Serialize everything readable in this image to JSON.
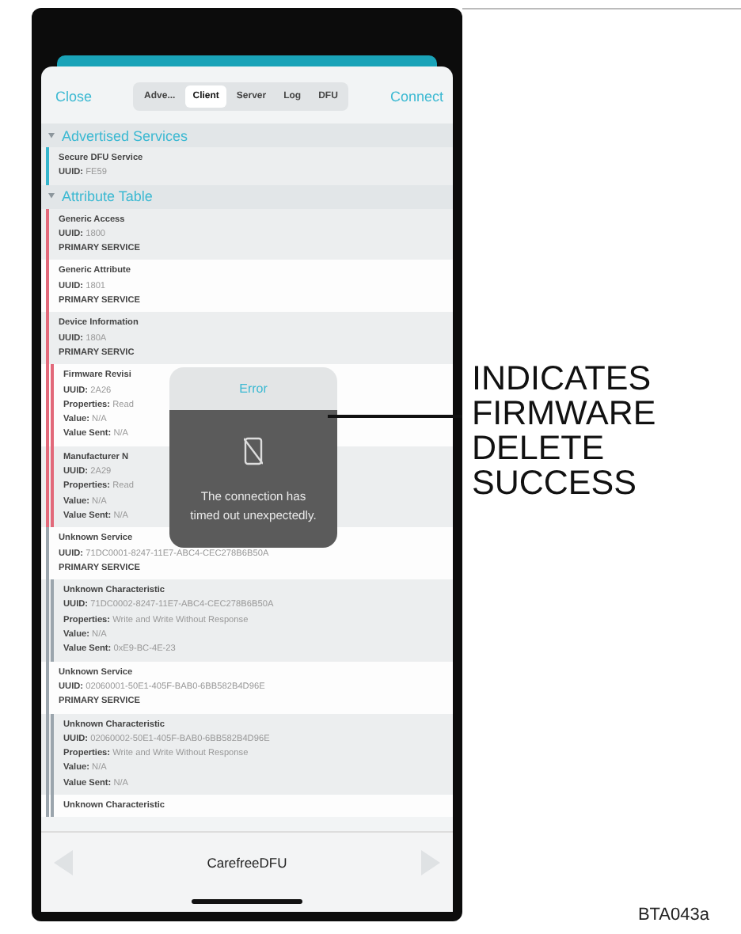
{
  "nav": {
    "close": "Close",
    "connect": "Connect",
    "segments": [
      {
        "label": "Adve...",
        "selected": false
      },
      {
        "label": "Client",
        "selected": true
      },
      {
        "label": "Server",
        "selected": false
      },
      {
        "label": "Log",
        "selected": false
      },
      {
        "label": "DFU",
        "selected": false
      }
    ]
  },
  "sections": [
    {
      "title": "Advertised Services",
      "expanded": true,
      "rows": [
        {
          "kind": "service",
          "color": "#35b5cc",
          "title": "Secure DFU Service",
          "fields": [
            {
              "label": "UUID:",
              "value": "FE59"
            }
          ]
        }
      ]
    },
    {
      "title": "Attribute Table",
      "expanded": true,
      "rows": [
        {
          "kind": "service",
          "color": "#e2697a",
          "title": "Generic Access",
          "fields": [
            {
              "label": "UUID:",
              "value": "1800"
            },
            {
              "label": "PRIMARY SERVICE"
            }
          ]
        },
        {
          "kind": "service",
          "color": "#e2697a",
          "title": "Generic Attribute",
          "fields": [
            {
              "label": "UUID:",
              "value": "1801"
            },
            {
              "label": "PRIMARY SERVICE"
            }
          ]
        },
        {
          "kind": "service",
          "color": "#e2697a",
          "title": "Device Information",
          "fields": [
            {
              "label": "UUID:",
              "value": "180A"
            },
            {
              "label": "PRIMARY SERVIC"
            }
          ]
        },
        {
          "kind": "characteristic",
          "color": "#e2697a",
          "title": "Firmware Revisi",
          "fields": [
            {
              "label": "UUID:",
              "value": "2A26"
            },
            {
              "label": "Properties:",
              "value": "Read"
            },
            {
              "label": "Value:",
              "value": "N/A"
            },
            {
              "label": "Value Sent:",
              "value": "N/A"
            }
          ]
        },
        {
          "kind": "characteristic",
          "color": "#e2697a",
          "title": "Manufacturer N",
          "fields": [
            {
              "label": "UUID:",
              "value": "2A29"
            },
            {
              "label": "Properties:",
              "value": "Read"
            },
            {
              "label": "Value:",
              "value": "N/A"
            },
            {
              "label": "Value Sent:",
              "value": "N/A"
            }
          ]
        },
        {
          "kind": "service",
          "color": "#9ba5ad",
          "title": "Unknown Service",
          "fields": [
            {
              "label": "UUID:",
              "value": "71DC0001-8247-11E7-ABC4-CEC278B6B50A"
            },
            {
              "label": "PRIMARY SERVICE"
            }
          ]
        },
        {
          "kind": "characteristic",
          "color": "#9ba5ad",
          "title": "Unknown Characteristic",
          "fields": [
            {
              "label": "UUID:",
              "value": "71DC0002-8247-11E7-ABC4-CEC278B6B50A"
            },
            {
              "label": "Properties:",
              "value": "Write and Write Without Response"
            },
            {
              "label": "Value:",
              "value": "N/A"
            },
            {
              "label": "Value Sent:",
              "value": "0xE9-BC-4E-23"
            }
          ]
        },
        {
          "kind": "service",
          "color": "#9ba5ad",
          "title": "Unknown Service",
          "fields": [
            {
              "label": "UUID:",
              "value": "02060001-50E1-405F-BAB0-6BB582B4D96E"
            },
            {
              "label": "PRIMARY SERVICE"
            }
          ]
        },
        {
          "kind": "characteristic",
          "color": "#9ba5ad",
          "title": "Unknown Characteristic",
          "fields": [
            {
              "label": "UUID:",
              "value": "02060002-50E1-405F-BAB0-6BB582B4D96E"
            },
            {
              "label": "Properties:",
              "value": "Write and Write Without Response"
            },
            {
              "label": "Value:",
              "value": "N/A"
            },
            {
              "label": "Value Sent:",
              "value": "N/A"
            }
          ]
        },
        {
          "kind": "characteristic",
          "color": "#9ba5ad",
          "title": "Unknown Characteristic",
          "fields": []
        }
      ]
    }
  ],
  "alert": {
    "title": "Error",
    "message": "The connection has timed out unexpectedly."
  },
  "toolbar": {
    "title": "CarefreeDFU",
    "back_disabled": true,
    "forward_disabled": true
  },
  "callout": "INDICATES FIRMWARE DELETE SUCCESS",
  "figure_code": "BTA043a"
}
